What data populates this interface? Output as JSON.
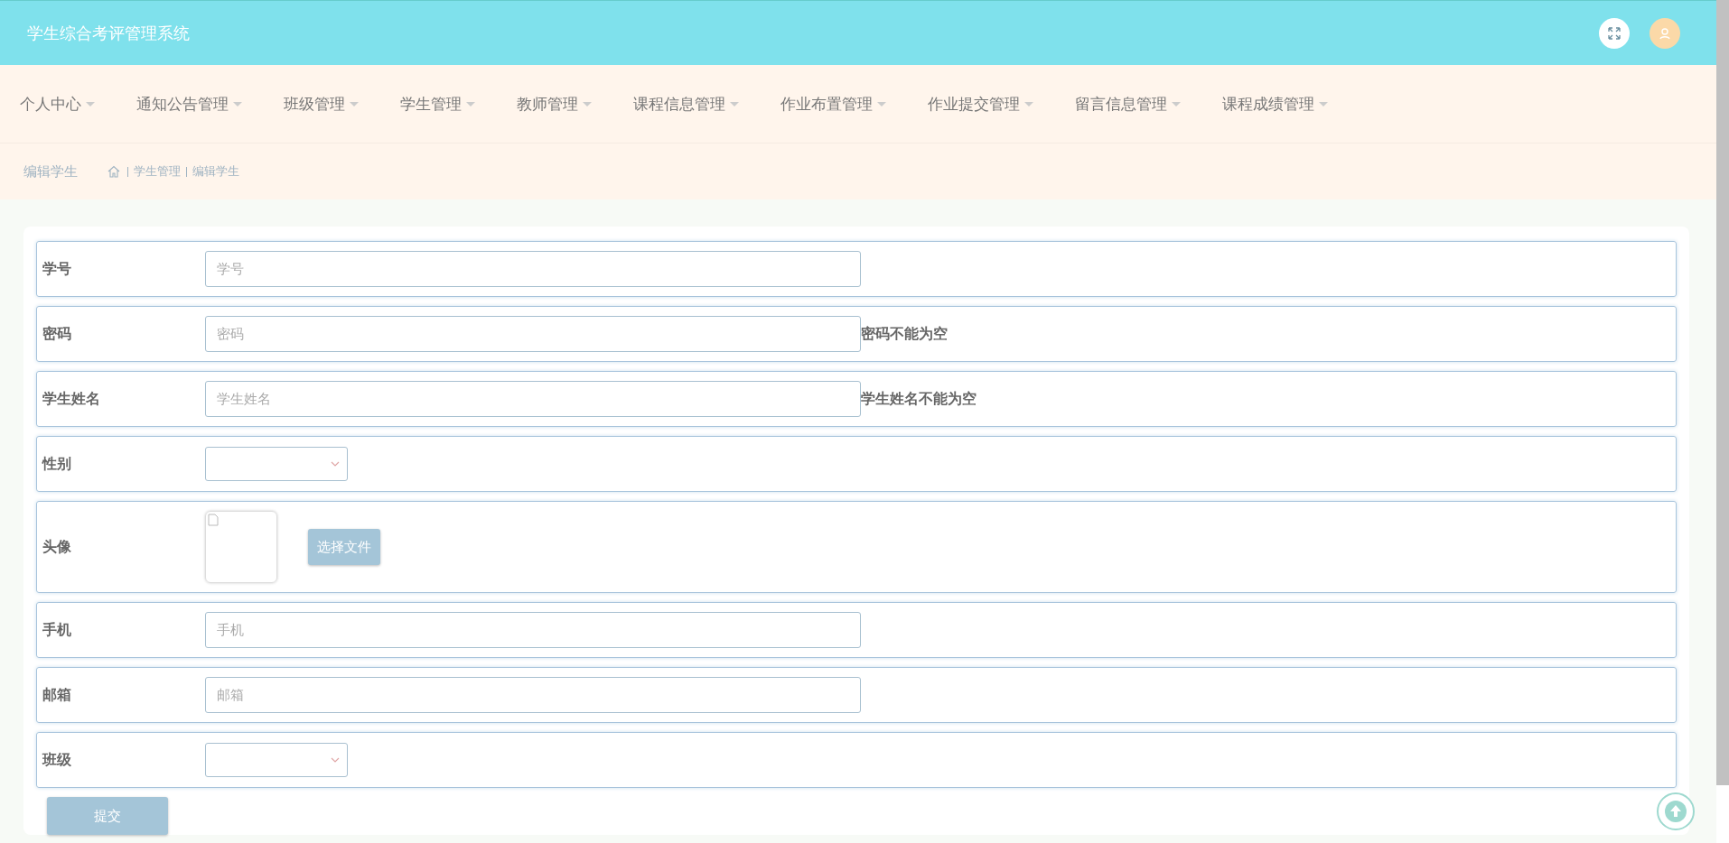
{
  "header": {
    "title": "学生综合考评管理系统"
  },
  "nav": [
    {
      "label": "个人中心",
      "has_dropdown": true
    },
    {
      "label": "通知公告管理",
      "has_dropdown": true
    },
    {
      "label": "班级管理",
      "has_dropdown": true
    },
    {
      "label": "学生管理",
      "has_dropdown": true
    },
    {
      "label": "教师管理",
      "has_dropdown": true
    },
    {
      "label": "课程信息管理",
      "has_dropdown": true
    },
    {
      "label": "作业布置管理",
      "has_dropdown": true
    },
    {
      "label": "作业提交管理",
      "has_dropdown": true
    },
    {
      "label": "留言信息管理",
      "has_dropdown": true
    },
    {
      "label": "课程成绩管理",
      "has_dropdown": true
    }
  ],
  "breadcrumb": {
    "page_title": "编辑学生",
    "items": [
      "学生管理",
      "编辑学生"
    ]
  },
  "form": {
    "fields": [
      {
        "kind": "text",
        "label": "学号",
        "placeholder": "学号"
      },
      {
        "kind": "text",
        "label": "密码",
        "placeholder": "密码",
        "error": "密码不能为空"
      },
      {
        "kind": "text",
        "label": "学生姓名",
        "placeholder": "学生姓名",
        "error": "学生姓名不能为空"
      },
      {
        "kind": "select",
        "label": "性别"
      },
      {
        "kind": "image",
        "label": "头像",
        "button": "选择文件"
      },
      {
        "kind": "text",
        "label": "手机",
        "placeholder": "手机"
      },
      {
        "kind": "text",
        "label": "邮箱",
        "placeholder": "邮箱"
      },
      {
        "kind": "select",
        "label": "班级"
      }
    ],
    "submit": "提交"
  }
}
